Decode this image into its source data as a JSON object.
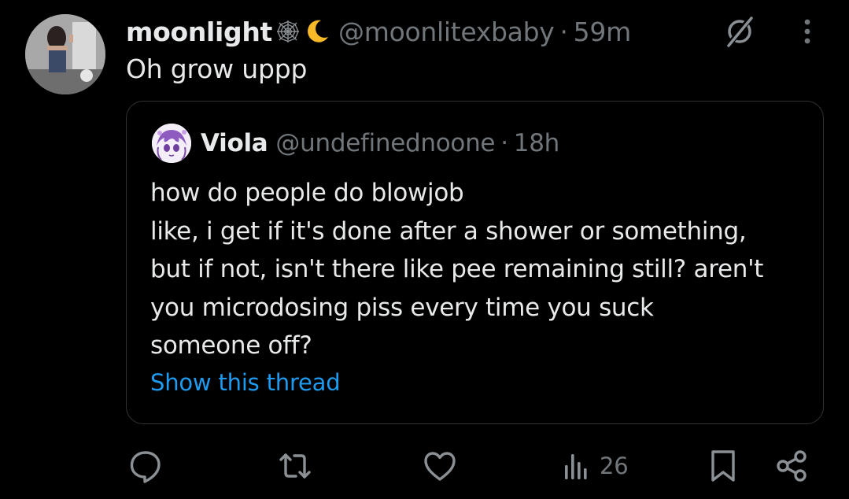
{
  "tweet": {
    "display_name": "moonlight",
    "name_emojis": [
      "spider-web-icon",
      "crescent-moon-icon"
    ],
    "handle": "@moonlitexbaby",
    "separator": "·",
    "time": "59m",
    "text": "Oh grow uppp"
  },
  "quote": {
    "display_name": "Viola",
    "handle": "@undefinednoone",
    "separator": "·",
    "time": "18h",
    "lines": [
      "how do people do blowjob",
      "like, i get if it's done after a shower or something,",
      "but if not, isn't there like pee remaining still? aren't",
      "you microdosing piss every time you suck",
      "someone off?"
    ],
    "show_thread": "Show this thread"
  },
  "actions": {
    "views": "26",
    "icons": [
      "reply-icon",
      "retweet-icon",
      "like-icon",
      "views-icon",
      "bookmark-icon",
      "share-icon"
    ]
  },
  "colors": {
    "background": "#000000",
    "primary_text": "#e7e9ea",
    "secondary_text": "#71767b",
    "link": "#1d9bf0",
    "border": "#2f3336"
  }
}
